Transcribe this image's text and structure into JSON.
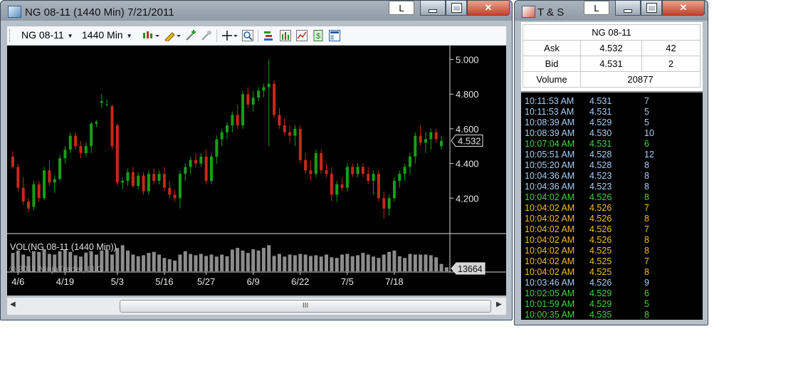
{
  "chart_window": {
    "title": "NG 08-11 (1440 Min)  7/21/2011",
    "l_button": "L",
    "toolbar": {
      "instrument": "NG 08-11",
      "period": "1440 Min"
    },
    "price_labels": [
      "5.000",
      "4.800",
      "4.600",
      "4.400",
      "4.200"
    ],
    "current_price": "4.532",
    "volume_label": "VOL(NG 08-11 (1440 Min))",
    "copyright": "© 2011 NinjaTrader, LLC",
    "current_volume": "13664",
    "date_labels": [
      "4/6",
      "4/19",
      "5/3",
      "5/16",
      "5/27",
      "6/9",
      "6/22",
      "7/5",
      "7/18"
    ],
    "scroll_thumb": "III",
    "colors": {
      "up": "#15a015",
      "down": "#c8281a",
      "volume": "#8c8c8c"
    }
  },
  "chart_data": {
    "type": "candlestick",
    "instrument": "NG 08-11",
    "ylim": [
      4.0,
      5.08
    ],
    "y_ticks": [
      4.2,
      4.4,
      4.6,
      4.8,
      5.0
    ],
    "candles": [
      [
        4.44,
        4.47,
        4.37,
        4.38
      ],
      [
        4.38,
        4.4,
        4.24,
        4.26
      ],
      [
        4.26,
        4.32,
        4.16,
        4.18
      ],
      [
        4.18,
        4.2,
        4.12,
        4.14
      ],
      [
        4.15,
        4.3,
        4.13,
        4.28
      ],
      [
        4.28,
        4.3,
        4.18,
        4.2
      ],
      [
        4.2,
        4.38,
        4.19,
        4.36
      ],
      [
        4.36,
        4.42,
        4.27,
        4.29
      ],
      [
        4.29,
        4.33,
        4.23,
        4.31
      ],
      [
        4.31,
        4.45,
        4.3,
        4.43
      ],
      [
        4.43,
        4.5,
        4.4,
        4.48
      ],
      [
        4.48,
        4.58,
        4.46,
        4.56
      ],
      [
        4.56,
        4.58,
        4.48,
        4.5
      ],
      [
        4.5,
        4.53,
        4.43,
        4.46
      ],
      [
        4.46,
        4.52,
        4.44,
        4.5
      ],
      [
        4.5,
        4.64,
        4.46,
        4.63
      ],
      [
        4.63,
        4.65,
        4.61,
        4.64
      ],
      [
        4.75,
        4.8,
        4.72,
        4.76
      ],
      [
        4.74,
        4.77,
        4.73,
        4.74
      ],
      [
        4.73,
        4.74,
        4.48,
        4.5
      ],
      [
        4.62,
        4.63,
        4.27,
        4.29
      ],
      [
        4.29,
        4.32,
        4.25,
        4.3
      ],
      [
        4.3,
        4.37,
        4.27,
        4.35
      ],
      [
        4.35,
        4.38,
        4.26,
        4.27
      ],
      [
        4.27,
        4.35,
        4.25,
        4.33
      ],
      [
        4.33,
        4.35,
        4.22,
        4.24
      ],
      [
        4.24,
        4.36,
        4.22,
        4.34
      ],
      [
        4.34,
        4.37,
        4.28,
        4.3
      ],
      [
        4.3,
        4.36,
        4.28,
        4.34
      ],
      [
        4.34,
        4.38,
        4.24,
        4.26
      ],
      [
        4.26,
        4.3,
        4.2,
        4.22
      ],
      [
        4.22,
        4.25,
        4.18,
        4.2
      ],
      [
        4.2,
        4.36,
        4.14,
        4.34
      ],
      [
        4.34,
        4.4,
        4.3,
        4.38
      ],
      [
        4.38,
        4.44,
        4.34,
        4.42
      ],
      [
        4.42,
        4.46,
        4.38,
        4.4
      ],
      [
        4.4,
        4.46,
        4.38,
        4.44
      ],
      [
        4.44,
        4.48,
        4.28,
        4.3
      ],
      [
        4.3,
        4.46,
        4.28,
        4.44
      ],
      [
        4.44,
        4.56,
        4.4,
        4.54
      ],
      [
        4.54,
        4.6,
        4.5,
        4.58
      ],
      [
        4.58,
        4.64,
        4.54,
        4.62
      ],
      [
        4.62,
        4.7,
        4.58,
        4.68
      ],
      [
        4.68,
        4.74,
        4.6,
        4.62
      ],
      [
        4.62,
        4.82,
        4.6,
        4.8
      ],
      [
        4.8,
        4.84,
        4.72,
        4.74
      ],
      [
        4.74,
        4.82,
        4.7,
        4.78
      ],
      [
        4.78,
        4.84,
        4.76,
        4.82
      ],
      [
        4.82,
        4.86,
        4.78,
        4.84
      ],
      [
        4.84,
        5.0,
        4.5,
        4.86
      ],
      [
        4.86,
        4.88,
        4.66,
        4.68
      ],
      [
        4.68,
        4.72,
        4.6,
        4.62
      ],
      [
        4.62,
        4.66,
        4.56,
        4.58
      ],
      [
        4.58,
        4.62,
        4.52,
        4.56
      ],
      [
        4.56,
        4.62,
        4.5,
        4.6
      ],
      [
        4.6,
        4.62,
        4.4,
        4.42
      ],
      [
        4.42,
        4.46,
        4.34,
        4.36
      ],
      [
        4.36,
        4.42,
        4.3,
        4.34
      ],
      [
        4.34,
        4.48,
        4.32,
        4.46
      ],
      [
        4.46,
        4.48,
        4.34,
        4.36
      ],
      [
        4.36,
        4.4,
        4.32,
        4.34
      ],
      [
        4.34,
        4.38,
        4.18,
        4.22
      ],
      [
        4.22,
        4.3,
        4.18,
        4.28
      ],
      [
        4.28,
        4.32,
        4.24,
        4.26
      ],
      [
        4.26,
        4.4,
        4.24,
        4.38
      ],
      [
        4.38,
        4.4,
        4.32,
        4.34
      ],
      [
        4.34,
        4.4,
        4.32,
        4.38
      ],
      [
        4.38,
        4.4,
        4.32,
        4.34
      ],
      [
        4.34,
        4.38,
        4.28,
        4.3
      ],
      [
        4.3,
        4.36,
        4.22,
        4.34
      ],
      [
        4.34,
        4.36,
        4.18,
        4.2
      ],
      [
        4.2,
        4.24,
        4.08,
        4.14
      ],
      [
        4.14,
        4.22,
        4.1,
        4.2
      ],
      [
        4.2,
        4.32,
        4.18,
        4.3
      ],
      [
        4.3,
        4.36,
        4.26,
        4.34
      ],
      [
        4.34,
        4.4,
        4.3,
        4.38
      ],
      [
        4.38,
        4.46,
        4.34,
        4.44
      ],
      [
        4.44,
        4.58,
        4.4,
        4.56
      ],
      [
        4.56,
        4.62,
        4.5,
        4.52
      ],
      [
        4.52,
        4.58,
        4.46,
        4.54
      ],
      [
        4.54,
        4.6,
        4.48,
        4.58
      ],
      [
        4.58,
        4.6,
        4.52,
        4.54
      ],
      [
        4.5,
        4.56,
        4.48,
        4.53
      ]
    ],
    "volume": [
      0.55,
      0.62,
      0.5,
      0.45,
      0.6,
      0.58,
      0.66,
      0.52,
      0.5,
      0.6,
      0.64,
      0.58,
      0.48,
      0.44,
      0.56,
      0.6,
      0.5,
      0.62,
      0.65,
      0.5,
      0.7,
      0.78,
      0.62,
      0.5,
      0.45,
      0.48,
      0.55,
      0.58,
      0.5,
      0.4,
      0.36,
      0.32,
      0.5,
      0.6,
      0.52,
      0.48,
      0.52,
      0.46,
      0.5,
      0.44,
      0.5,
      0.45,
      0.65,
      0.7,
      0.62,
      0.55,
      0.66,
      0.62,
      0.7,
      0.78,
      0.46,
      0.52,
      0.44,
      0.5,
      0.48,
      0.52,
      0.5,
      0.46,
      0.48,
      0.44,
      0.5,
      0.42,
      0.4,
      0.5,
      0.52,
      0.45,
      0.48,
      0.55,
      0.5,
      0.44,
      0.4,
      0.5,
      0.58,
      0.62,
      0.45,
      0.4,
      0.52,
      0.5,
      0.5,
      0.5,
      0.48,
      0.42,
      0.22,
      0.12
    ]
  },
  "ts_window": {
    "title": "T & S",
    "l_button": "L",
    "instrument": "NG 08-11",
    "quote": [
      {
        "label": "Ask",
        "price": "4.532",
        "size": "42"
      },
      {
        "label": "Bid",
        "price": "4.531",
        "size": "2"
      }
    ],
    "volume_label": "Volume",
    "volume_value": "20877",
    "colors": {
      "neutral": "#a9cff5",
      "up": "#46d246",
      "down": "#f0c020"
    },
    "trades": [
      {
        "time": "10:11:53 AM",
        "price": "4.531",
        "size": "7",
        "side": "neutral"
      },
      {
        "time": "10:11:53 AM",
        "price": "4.531",
        "size": "5",
        "side": "neutral"
      },
      {
        "time": "10:08:39 AM",
        "price": "4.529",
        "size": "5",
        "side": "neutral"
      },
      {
        "time": "10:08:39 AM",
        "price": "4.530",
        "size": "10",
        "side": "neutral"
      },
      {
        "time": "10:07:04 AM",
        "price": "4.531",
        "size": "6",
        "side": "up"
      },
      {
        "time": "10:05:51 AM",
        "price": "4.528",
        "size": "12",
        "side": "neutral"
      },
      {
        "time": "10:05:20 AM",
        "price": "4.528",
        "size": "8",
        "side": "neutral"
      },
      {
        "time": "10:04:36 AM",
        "price": "4.523",
        "size": "8",
        "side": "neutral"
      },
      {
        "time": "10:04:36 AM",
        "price": "4.523",
        "size": "8",
        "side": "neutral"
      },
      {
        "time": "10:04:02 AM",
        "price": "4.526",
        "size": "8",
        "side": "up"
      },
      {
        "time": "10:04:02 AM",
        "price": "4.526",
        "size": "7",
        "side": "down"
      },
      {
        "time": "10:04:02 AM",
        "price": "4.526",
        "size": "8",
        "side": "down"
      },
      {
        "time": "10:04:02 AM",
        "price": "4.526",
        "size": "7",
        "side": "down"
      },
      {
        "time": "10:04:02 AM",
        "price": "4.526",
        "size": "8",
        "side": "down"
      },
      {
        "time": "10:04:02 AM",
        "price": "4.525",
        "size": "8",
        "side": "down"
      },
      {
        "time": "10:04:02 AM",
        "price": "4.525",
        "size": "7",
        "side": "down"
      },
      {
        "time": "10:04:02 AM",
        "price": "4.525",
        "size": "8",
        "side": "down"
      },
      {
        "time": "10:03:46 AM",
        "price": "4.526",
        "size": "9",
        "side": "neutral"
      },
      {
        "time": "10:02:05 AM",
        "price": "4.529",
        "size": "6",
        "side": "up"
      },
      {
        "time": "10:01:59 AM",
        "price": "4.529",
        "size": "5",
        "side": "up"
      },
      {
        "time": "10:00:35 AM",
        "price": "4.535",
        "size": "8",
        "side": "up"
      }
    ]
  }
}
